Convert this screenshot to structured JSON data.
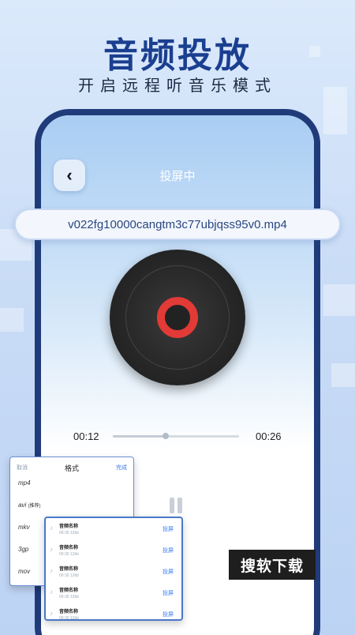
{
  "promo": {
    "headline": "音频投放",
    "subline": "开启远程听音乐模式"
  },
  "screen": {
    "back_icon": "‹",
    "title": "投屏中",
    "filename": "v022fg10000cangtm3c77ubjqss95v0.mp4",
    "player": {
      "current_time": "00:12",
      "total_time": "00:26",
      "progress_fraction": 0.42
    }
  },
  "format_card": {
    "cancel": "取消",
    "title": "格式",
    "done": "完成",
    "items": [
      {
        "label": "mp4",
        "note": ""
      },
      {
        "label": "avi",
        "note": "(推荐)"
      },
      {
        "label": "mkv",
        "note": ""
      },
      {
        "label": "3gp",
        "note": ""
      },
      {
        "label": "mov",
        "note": ""
      }
    ]
  },
  "audio_list": {
    "rows": [
      {
        "name": "音频名称",
        "meta": "00:30  12kb",
        "action": "投屏"
      },
      {
        "name": "音频名称",
        "meta": "00:30  12kb",
        "action": "投屏"
      },
      {
        "name": "音频名称",
        "meta": "00:30  12kb",
        "action": "投屏"
      },
      {
        "name": "音频名称",
        "meta": "00:30  12kb",
        "action": "投屏"
      },
      {
        "name": "音频名称",
        "meta": "00:30  12kb",
        "action": "投屏"
      }
    ]
  },
  "badge": "搜软下载",
  "colors": {
    "headline": "#1b3f8f",
    "frame": "#1f3b7a",
    "disc_label": "#e23a36",
    "accent": "#3a7bf0"
  }
}
